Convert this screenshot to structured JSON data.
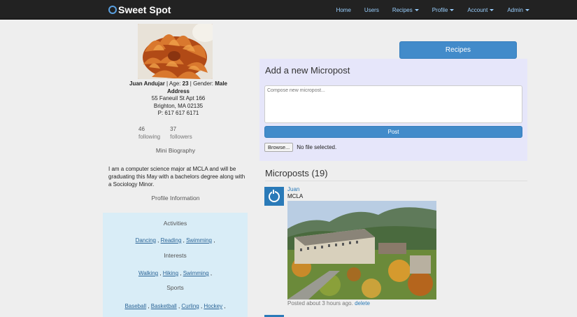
{
  "brand": {
    "name": "Sweet Spot"
  },
  "nav": {
    "home": "Home",
    "users": "Users",
    "recipes": "Recipes",
    "profile": "Profile",
    "account": "Account",
    "admin": "Admin"
  },
  "profile": {
    "name": "Juan Andujar",
    "age_label": "Age:",
    "age": "23",
    "gender_label": "Gender:",
    "gender": "Male",
    "address_label": "Address",
    "street": "55 Faneuil St Apt 166",
    "city": "Brighton, MA 02135",
    "phone": "P: 617 617 6171",
    "following_count": "46",
    "following_label": "following",
    "followers_count": "37",
    "followers_label": "followers",
    "bio_title": "Mini Biography",
    "bio": "I am a computer science major at MCLA and will be graduating this May with a bachelors degree along with a Sociology Minor.",
    "info_title": "Profile Information"
  },
  "interests_box": {
    "activities_title": "Activities",
    "activities": [
      "Dancing",
      "Reading",
      "Swimming"
    ],
    "interests_title": "Interests",
    "interests": [
      "Walking",
      "Hiking",
      "Swimming"
    ],
    "sports_title": "Sports",
    "sports": [
      "Baseball",
      "Basketball",
      "Curling",
      "Hockey"
    ]
  },
  "recipes_button": "Recipes",
  "micropost_form": {
    "title": "Add a new Micropost",
    "placeholder": "Compose new micropost...",
    "post_button": "Post",
    "browse_button": "Browse...",
    "file_status": "No file selected."
  },
  "microposts": {
    "title": "Microposts (19)",
    "items": [
      {
        "user": "Juan",
        "content": "MCLA",
        "timestamp": "Posted about 3 hours ago.",
        "delete": "delete"
      }
    ]
  },
  "colors": {
    "navbar": "#222222",
    "accent": "#428bca",
    "panel": "#e6e6fa",
    "info_box": "#d9edf7"
  }
}
